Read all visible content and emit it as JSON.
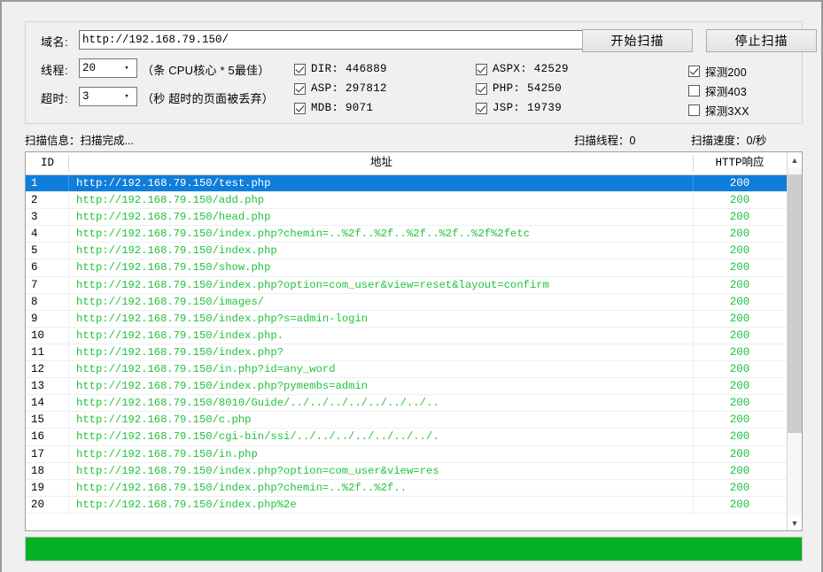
{
  "settings": {
    "domain": {
      "label": "域名:",
      "value": "http://192.168.79.150/",
      "placeholder": ""
    },
    "threads": {
      "label": "线程:",
      "value": "20",
      "note": "（条 CPU核心 * 5最佳）"
    },
    "timeout": {
      "label": "超时:",
      "value": "3",
      "note": "（秒 超时的页面被丢弃）"
    },
    "dict_checkboxes_col1": [
      {
        "name": "dir",
        "label": "DIR: 446889",
        "checked": true
      },
      {
        "name": "asp",
        "label": "ASP: 297812",
        "checked": true
      },
      {
        "name": "mdb",
        "label": "MDB: 9071",
        "checked": true
      }
    ],
    "dict_checkboxes_col2": [
      {
        "name": "aspx",
        "label": "ASPX: 42529",
        "checked": true
      },
      {
        "name": "php",
        "label": "PHP: 54250",
        "checked": true
      },
      {
        "name": "jsp",
        "label": "JSP: 19739",
        "checked": true
      }
    ],
    "probe_checkboxes": [
      {
        "name": "probe-200",
        "label": "探测200",
        "checked": true
      },
      {
        "name": "probe-403",
        "label": "探测403",
        "checked": false
      },
      {
        "name": "probe-3xx",
        "label": "探测3XX",
        "checked": false
      }
    ]
  },
  "buttons": {
    "start_scan": "开始扫描",
    "stop_scan": "停止扫描"
  },
  "status": {
    "scan_info": "扫描信息：扫描完成...",
    "scan_threads": "扫描线程：0",
    "scan_speed": "扫描速度：0/秒"
  },
  "table": {
    "columns": [
      "ID",
      "地址",
      "HTTP响应"
    ],
    "rows": [
      {
        "id": "1",
        "url": "http://192.168.79.150/test.php",
        "code": "200",
        "selected": true
      },
      {
        "id": "2",
        "url": "http://192.168.79.150/add.php",
        "code": "200",
        "selected": false
      },
      {
        "id": "3",
        "url": "http://192.168.79.150/head.php",
        "code": "200",
        "selected": false
      },
      {
        "id": "4",
        "url": "http://192.168.79.150/index.php?chemin=..%2f..%2f..%2f..%2f..%2f%2fetc",
        "code": "200",
        "selected": false
      },
      {
        "id": "5",
        "url": "http://192.168.79.150/index.php",
        "code": "200",
        "selected": false
      },
      {
        "id": "6",
        "url": "http://192.168.79.150/show.php",
        "code": "200",
        "selected": false
      },
      {
        "id": "7",
        "url": "http://192.168.79.150/index.php?option=com_user&view=reset&layout=confirm",
        "code": "200",
        "selected": false
      },
      {
        "id": "8",
        "url": "http://192.168.79.150/images/",
        "code": "200",
        "selected": false
      },
      {
        "id": "9",
        "url": "http://192.168.79.150/index.php?s=admin-login",
        "code": "200",
        "selected": false
      },
      {
        "id": "10",
        "url": "http://192.168.79.150/index.php.",
        "code": "200",
        "selected": false
      },
      {
        "id": "11",
        "url": "http://192.168.79.150/index.php?",
        "code": "200",
        "selected": false
      },
      {
        "id": "12",
        "url": "http://192.168.79.150/in.php?id=any_word",
        "code": "200",
        "selected": false
      },
      {
        "id": "13",
        "url": "http://192.168.79.150/index.php?pymembs=admin",
        "code": "200",
        "selected": false
      },
      {
        "id": "14",
        "url": "http://192.168.79.150/8010/Guide/../../../../../../../..",
        "code": "200",
        "selected": false
      },
      {
        "id": "15",
        "url": "http://192.168.79.150/c.php",
        "code": "200",
        "selected": false
      },
      {
        "id": "16",
        "url": "http://192.168.79.150/cgi-bin/ssi/../../../../../../../.",
        "code": "200",
        "selected": false
      },
      {
        "id": "17",
        "url": "http://192.168.79.150/in.php",
        "code": "200",
        "selected": false
      },
      {
        "id": "18",
        "url": "http://192.168.79.150/index.php?option=com_user&view=res",
        "code": "200",
        "selected": false
      },
      {
        "id": "19",
        "url": "http://192.168.79.150/index.php?chemin=..%2f..%2f..",
        "code": "200",
        "selected": false
      },
      {
        "id": "20",
        "url": "http://192.168.79.150/index.php%2e",
        "code": "200",
        "selected": false
      }
    ]
  },
  "scrollbar": {
    "up_arrow": "⌃",
    "down_arrow": "⌄"
  },
  "progress": {
    "color": "#06b025",
    "percent": 100
  }
}
